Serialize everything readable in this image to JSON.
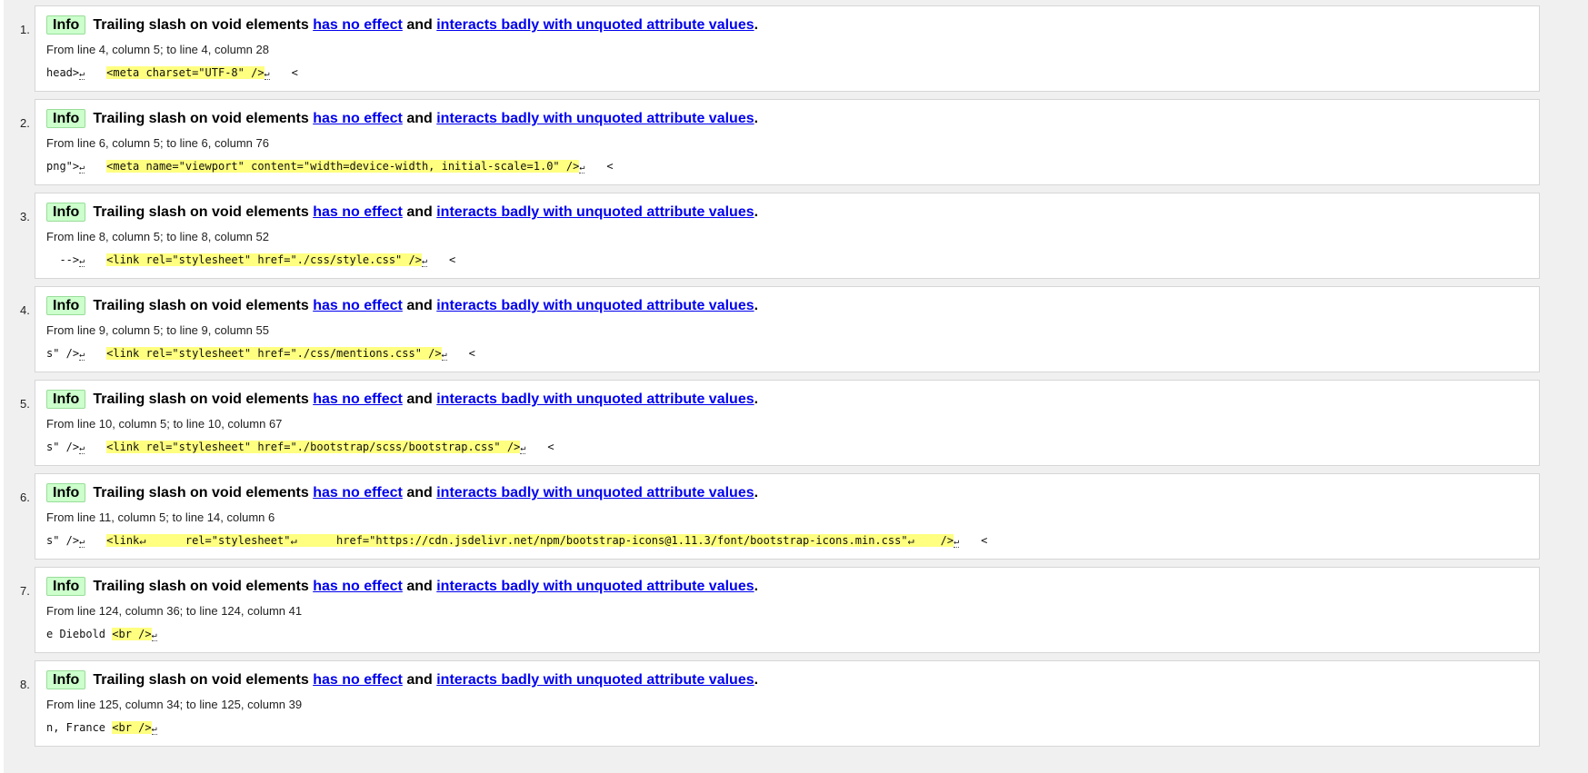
{
  "messages": [
    {
      "number": "1.",
      "type": "Info",
      "text": "Trailing slash on void elements",
      "link1": "has no effect",
      "conj": "and",
      "link2": "interacts badly with unquoted attribute values",
      "period": ".",
      "location": "From line 4, column 5; to line 4, column 28",
      "pre": "head>",
      "hilite": "<meta charset=\"UTF-8\" />",
      "post": "<"
    },
    {
      "number": "2.",
      "type": "Info",
      "text": "Trailing slash on void elements",
      "link1": "has no effect",
      "conj": "and",
      "link2": "interacts badly with unquoted attribute values",
      "period": ".",
      "location": "From line 6, column 5; to line 6, column 76",
      "pre": "png\">",
      "hilite": "<meta name=\"viewport\" content=\"width=device-width, initial-scale=1.0\" />",
      "post": "<"
    },
    {
      "number": "3.",
      "type": "Info",
      "text": "Trailing slash on void elements",
      "link1": "has no effect",
      "conj": "and",
      "link2": "interacts badly with unquoted attribute values",
      "period": ".",
      "location": "From line 8, column 5; to line 8, column 52",
      "pre": "  -->",
      "hilite": "<link rel=\"stylesheet\" href=\"./css/style.css\" />",
      "post": "<"
    },
    {
      "number": "4.",
      "type": "Info",
      "text": "Trailing slash on void elements",
      "link1": "has no effect",
      "conj": "and",
      "link2": "interacts badly with unquoted attribute values",
      "period": ".",
      "location": "From line 9, column 5; to line 9, column 55",
      "pre": "s\" />",
      "hilite": "<link rel=\"stylesheet\" href=\"./css/mentions.css\" />",
      "post": "<"
    },
    {
      "number": "5.",
      "type": "Info",
      "text": "Trailing slash on void elements",
      "link1": "has no effect",
      "conj": "and",
      "link2": "interacts badly with unquoted attribute values",
      "period": ".",
      "location": "From line 10, column 5; to line 10, column 67",
      "pre": "s\" />",
      "hilite": "<link rel=\"stylesheet\" href=\"./bootstrap/scss/bootstrap.css\" />",
      "post": "<"
    },
    {
      "number": "6.",
      "type": "Info",
      "text": "Trailing slash on void elements",
      "link1": "has no effect",
      "conj": "and",
      "link2": "interacts badly with unquoted attribute values",
      "period": ".",
      "location": "From line 11, column 5; to line 14, column 6",
      "pre": "s\" />",
      "hilite": "<link↵      rel=\"stylesheet\"↵      href=\"https://cdn.jsdelivr.net/npm/bootstrap-icons@1.11.3/font/bootstrap-icons.min.css\"↵    />",
      "post": "<"
    },
    {
      "number": "7.",
      "type": "Info",
      "text": "Trailing slash on void elements",
      "link1": "has no effect",
      "conj": "and",
      "link2": "interacts badly with unquoted attribute values",
      "period": ".",
      "location": "From line 124, column 36; to line 124, column 41",
      "pre": "e Diebold ",
      "hilite": "<br />",
      "post": ""
    },
    {
      "number": "8.",
      "type": "Info",
      "text": "Trailing slash on void elements",
      "link1": "has no effect",
      "conj": "and",
      "link2": "interacts badly with unquoted attribute values",
      "period": ".",
      "location": "From line 125, column 34; to line 125, column 39",
      "pre": "n, France ",
      "hilite": "<br />",
      "post": ""
    }
  ],
  "linefeed_glyph": "↵",
  "colors": {
    "info_badge_bg": "#ccffcc",
    "highlight": "#ffff80",
    "link": "#0000ee",
    "panel_bg": "#f0f0f0"
  }
}
